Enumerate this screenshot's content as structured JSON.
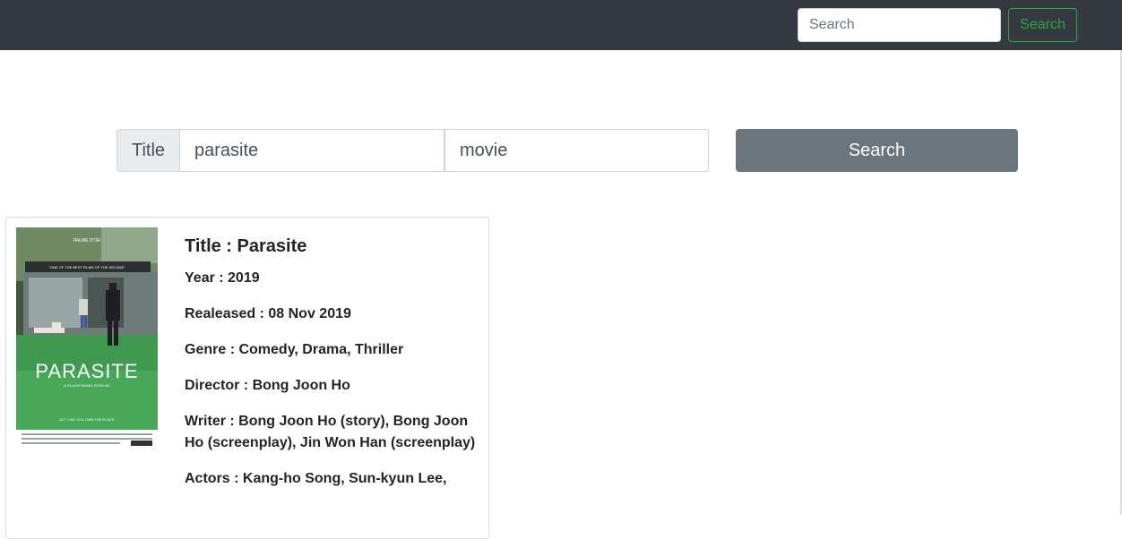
{
  "navbar": {
    "search_placeholder": "Search",
    "search_button": "Search"
  },
  "search_form": {
    "prefix_label": "Title",
    "title_value": "parasite",
    "type_value": "movie",
    "submit_label": "Search"
  },
  "movie": {
    "title": "Title : Parasite",
    "year": "Year : 2019",
    "released": "Realeased : 08 Nov 2019",
    "genre": "Genre : Comedy, Drama, Thriller",
    "director": "Director : Bong Joon Ho",
    "writer": "Writer : Bong Joon Ho (story), Bong Joon Ho (screenplay), Jin Won Han (screenplay)",
    "actors": "Actors : Kang-ho Song, Sun-kyun Lee,",
    "poster": {
      "title_text": "PARASITE",
      "tagline": "\"ONE OF THE BEST FILMS OF THE DECADE\"",
      "award": "PALME D'OR",
      "credit": "A FILM BY BONG JOON HO",
      "bottom_text": "ACT LIKE YOU OWN THE PLACE"
    }
  },
  "colors": {
    "navbar_bg": "#343a40",
    "accent_green": "#28a745",
    "button_gray": "#6c757d"
  }
}
